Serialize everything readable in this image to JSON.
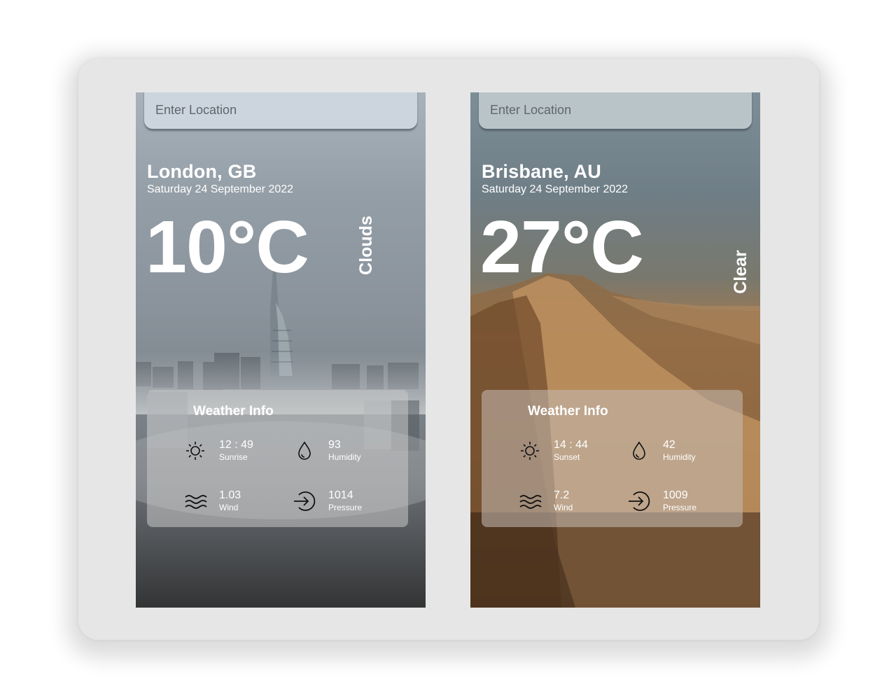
{
  "cards": [
    {
      "search": {
        "placeholder": "Enter Location"
      },
      "city": "London, GB",
      "date": "Saturday 24 September 2022",
      "temperature": "10°C",
      "condition": "Clouds",
      "info": {
        "title": "Weather Info",
        "sun": {
          "value": "12 : 49",
          "label": "Sunrise"
        },
        "humidity": {
          "value": "93",
          "label": "Humidity"
        },
        "wind": {
          "value": "1.03",
          "label": "Wind"
        },
        "pressure": {
          "value": "1014",
          "label": "Pressure"
        }
      }
    },
    {
      "search": {
        "placeholder": "Enter Location"
      },
      "city": "Brisbane, AU",
      "date": "Saturday 24 September 2022",
      "temperature": "27°C",
      "condition": "Clear",
      "info": {
        "title": "Weather Info",
        "sun": {
          "value": "14 : 44",
          "label": "Sunset"
        },
        "humidity": {
          "value": "42",
          "label": "Humidity"
        },
        "wind": {
          "value": "7.2",
          "label": "Wind"
        },
        "pressure": {
          "value": "1009",
          "label": "Pressure"
        }
      }
    }
  ],
  "icons": {
    "sun": "sun-icon",
    "humidity": "water-drop-icon",
    "wind": "wind-icon",
    "pressure": "login-arrow-icon"
  }
}
